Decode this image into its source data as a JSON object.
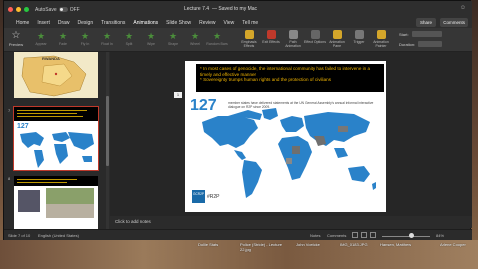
{
  "window": {
    "autosave_label": "AutoSave",
    "autosave_state": "OFF",
    "title": "Lecture 7.4",
    "title_status": "— Saved to my Mac",
    "tell_me": "Tell me"
  },
  "menu": {
    "items": [
      "Home",
      "Insert",
      "Draw",
      "Design",
      "Transitions",
      "Animations",
      "Slide Show",
      "Review",
      "View",
      "Tell me"
    ],
    "active": "Animations",
    "share_label": "Share",
    "comments_label": "Comments"
  },
  "ribbon": {
    "preview_label": "Preview",
    "animations": [
      "Appear",
      "Fade",
      "Fly In",
      "Float In",
      "Split",
      "Wipe",
      "Shape",
      "Wheel",
      "Random Bars",
      "Grow & Turn"
    ],
    "tools": [
      "Emphasis Effects",
      "Exit Effects",
      "Path Animation",
      "Effect Options",
      "Animation Pane",
      "Trigger",
      "Animation Painter"
    ],
    "start_label": "Start:",
    "duration_label": "Duration:"
  },
  "slides_pane": {
    "slide_numbers": [
      "6",
      "7",
      "8"
    ],
    "slide6_title": "RWANDA",
    "slide7_number": "127"
  },
  "slide": {
    "badge": "1",
    "banner_lines": [
      "* In most cases of genocide, the international community has failed to intervene in a timely and effective manner",
      "* Sovereignty trumps human rights and the protection of civilians"
    ],
    "map_number": "127",
    "map_caption": "member states have delivered statements at the UN General Assembly's annual informal interactive dialogue on R2P since 2009.",
    "logo_text": "GCR2P",
    "hashtag": "#R2P"
  },
  "notes": {
    "placeholder": "Click to add notes"
  },
  "status": {
    "slide_info": "Slide 7 of 10",
    "language": "English (United States)",
    "notes_label": "Notes",
    "comments_label": "Comments",
    "zoom": "84%"
  },
  "desktop_files": [
    "Dollie Stats",
    "Police (Stride) - Lecture 22.jpg",
    "John Voelcke",
    "IMG_0183.JPG",
    "Hansen, Matthew",
    "Arlene Cooper"
  ],
  "colors": {
    "accent": "#e37c3e",
    "banner_bg": "#000000",
    "banner_text": "#f0b400",
    "map_blue": "#2a82c9",
    "selected_outline": "#c0392b"
  }
}
